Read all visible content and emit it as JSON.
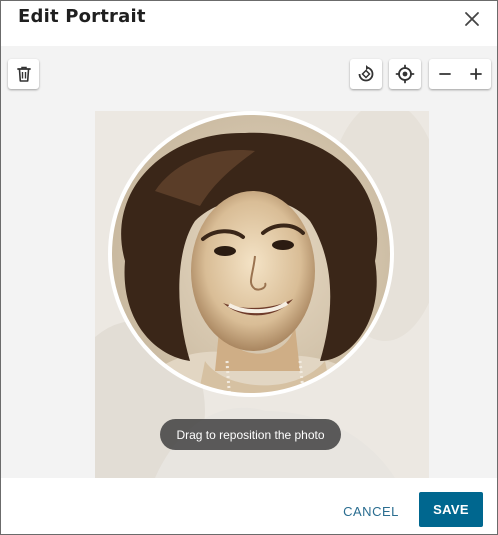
{
  "dialog": {
    "title": "Edit Portrait",
    "close_icon": "close-icon"
  },
  "toolbar": {
    "delete_icon": "trash-icon",
    "rotate_icon": "rotate-icon",
    "center_icon": "crosshair-icon",
    "zoom_out_label": "−",
    "zoom_in_label": "+"
  },
  "editor": {
    "hint": "Drag to reposition the photo",
    "photo_alt": "Vintage sepia portrait of a smiling woman with dark wavy hair"
  },
  "footer": {
    "cancel_label": "CANCEL",
    "save_label": "SAVE"
  },
  "colors": {
    "primary": "#00678f",
    "link": "#2a6d90",
    "stage_bg": "#f3f3f3",
    "hint_bg": "#464646"
  }
}
